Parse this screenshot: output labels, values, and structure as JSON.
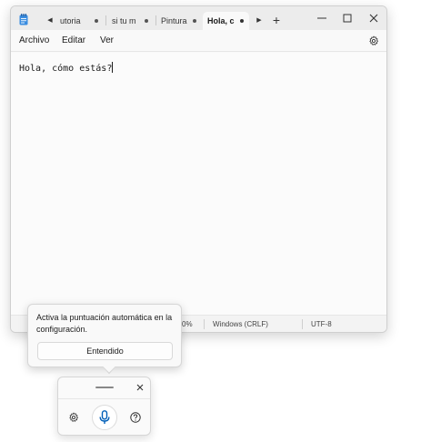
{
  "tabs": [
    {
      "label": "utoria",
      "active": false
    },
    {
      "label": "si tu m",
      "active": false
    },
    {
      "label": "Pintura",
      "active": false
    },
    {
      "label": "Hola, c",
      "active": true
    }
  ],
  "new_tab_label": "+",
  "menu": {
    "archivo": "Archivo",
    "editar": "Editar",
    "ver": "Ver"
  },
  "editor": {
    "text": "Hola, cómo estás?"
  },
  "status": {
    "zoom": "0%",
    "line_ending": "Windows (CRLF)",
    "encoding": "UTF-8"
  },
  "tooltip": {
    "message": "Activa la puntuación automática en la configuración.",
    "button": "Entendido"
  },
  "colors": {
    "accent": "#005fb8",
    "titlebar": "#ececec",
    "surface": "#f9f9f9"
  },
  "icons": {
    "app": "notepad-icon",
    "settings": "gear-icon",
    "mic": "microphone-icon",
    "help": "help-icon",
    "close": "close-icon"
  }
}
